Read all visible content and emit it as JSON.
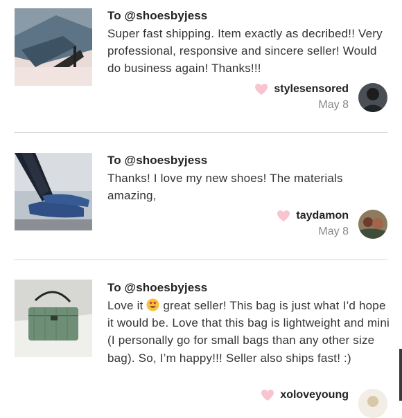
{
  "reviews": [
    {
      "to": "To @shoesbyjess",
      "message": "Super fast shipping. Item exactly as decribed!! Very professional, responsive and sincere seller! Would do business again! Thanks!!!",
      "username": "stylesensored",
      "date": "May 8"
    },
    {
      "to": "To @shoesbyjess",
      "message": "Thanks! I love my new shoes! The materials amazing,",
      "username": "taydamon",
      "date": "May 8"
    },
    {
      "to": "To @shoesbyjess",
      "message_before_emoji": "Love it ",
      "message_after_emoji": " great seller! This bag is just what I’d hope it would be. Love that this bag is lightweight and mini (I personally go for small bags than any other size bag). So, I’m happy!!! Seller also ships fast! :)",
      "username": "xoloveyoung",
      "date": ""
    }
  ],
  "colors": {
    "heart": "#f7c4cf",
    "divider": "#d9d9d9",
    "date": "#888888"
  },
  "icons": {
    "heart": "heart-icon",
    "emoji": "heart-eyes-emoji-icon"
  }
}
